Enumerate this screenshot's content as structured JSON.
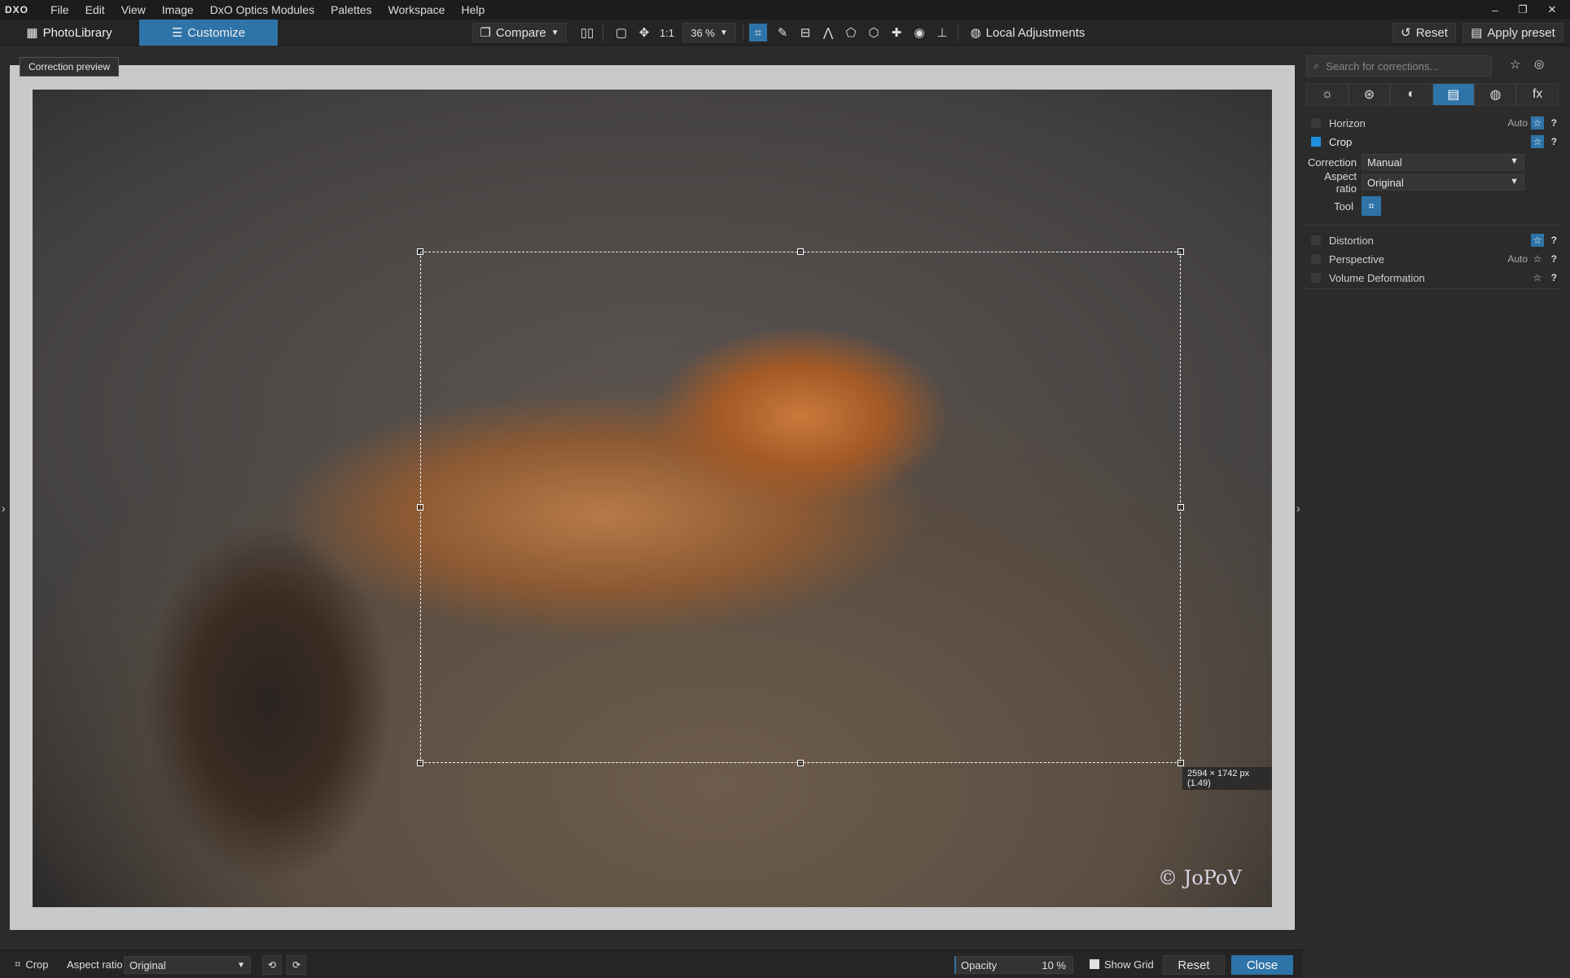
{
  "app": {
    "logo": "DXO"
  },
  "menu": [
    "File",
    "Edit",
    "View",
    "Image",
    "DxO Optics Modules",
    "Palettes",
    "Workspace",
    "Help"
  ],
  "window_controls": {
    "minimize": "–",
    "restore": "❐",
    "close": "✕"
  },
  "toolbar": {
    "photolibrary_label": "PhotoLibrary",
    "customize_label": "Customize",
    "compare_label": "Compare",
    "one_to_one": "1:1",
    "zoom": "36 %",
    "local_adjustments_label": "Local Adjustments",
    "reset_label": "Reset",
    "apply_preset_label": "Apply preset"
  },
  "viewer": {
    "tooltip": "Correction preview",
    "crop_dimensions": "2594 × 1742 px (1.49)",
    "watermark": "© JoPoV"
  },
  "panel": {
    "search_placeholder": "Search for corrections...",
    "tabs": [
      "☼",
      "⊛",
      "◐",
      "▤",
      "◍",
      "fx"
    ],
    "rows": {
      "horizon": {
        "label": "Horizon",
        "auto": "Auto"
      },
      "crop": {
        "label": "Crop"
      },
      "distortion": {
        "label": "Distortion"
      },
      "perspective": {
        "label": "Perspective",
        "auto": "Auto"
      },
      "volume": {
        "label": "Volume Deformation"
      }
    },
    "correction": {
      "label": "Correction",
      "value": "Manual"
    },
    "aspect_ratio": {
      "label": "Aspect ratio",
      "value": "Original"
    },
    "tool": {
      "label": "Tool"
    }
  },
  "bottom": {
    "crop_label": "Crop",
    "aspect_ratio_label": "Aspect ratio",
    "aspect_ratio_value": "Original",
    "opacity_label": "Opacity",
    "opacity_value": "10 %",
    "show_grid_label": "Show Grid",
    "reset_label": "Reset",
    "close_label": "Close"
  },
  "colors": {
    "accent": "#2f74a8",
    "check_on": "#1f8fe0"
  }
}
